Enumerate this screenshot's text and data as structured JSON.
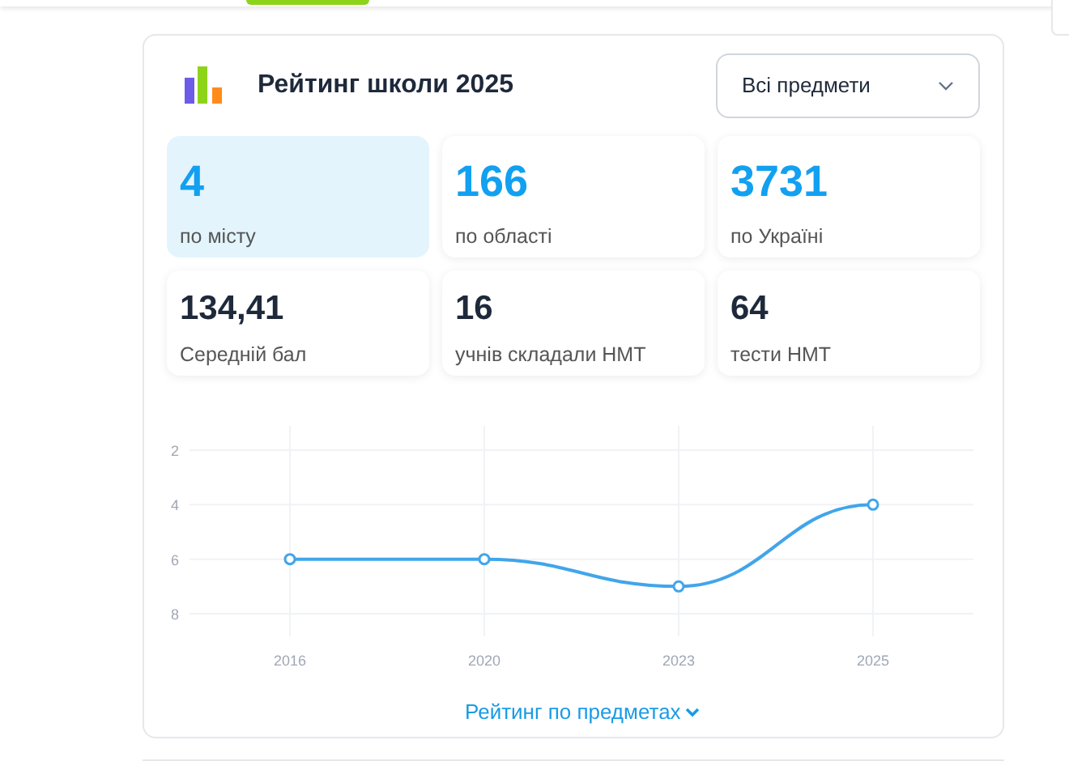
{
  "card": {
    "title": "Рейтинг школи 2025",
    "subject_select": {
      "value": "Всі предмети"
    },
    "stats": [
      {
        "value": "4",
        "label": "по місту",
        "selected": true,
        "kind": "rank"
      },
      {
        "value": "166",
        "label": "по області",
        "selected": false,
        "kind": "rank"
      },
      {
        "value": "3731",
        "label": "по Україні",
        "selected": false,
        "kind": "rank"
      },
      {
        "value": "134,41",
        "label": "Середній бал",
        "selected": false,
        "kind": "info"
      },
      {
        "value": "16",
        "label": "учнів складали НМТ",
        "selected": false,
        "kind": "info"
      },
      {
        "value": "64",
        "label": "тести НМТ",
        "selected": false,
        "kind": "info"
      }
    ],
    "chart_data": {
      "type": "line",
      "categories": [
        "2016",
        "2020",
        "2023",
        "2025"
      ],
      "series": [
        {
          "color": "#41a5ea",
          "marker": "circle",
          "values": [
            6,
            6,
            7,
            4
          ]
        }
      ],
      "yticks": [
        2,
        4,
        6,
        8
      ],
      "ylim": [
        8,
        2
      ],
      "grid": true
    },
    "footer_link": "Рейтинг по предметах"
  }
}
